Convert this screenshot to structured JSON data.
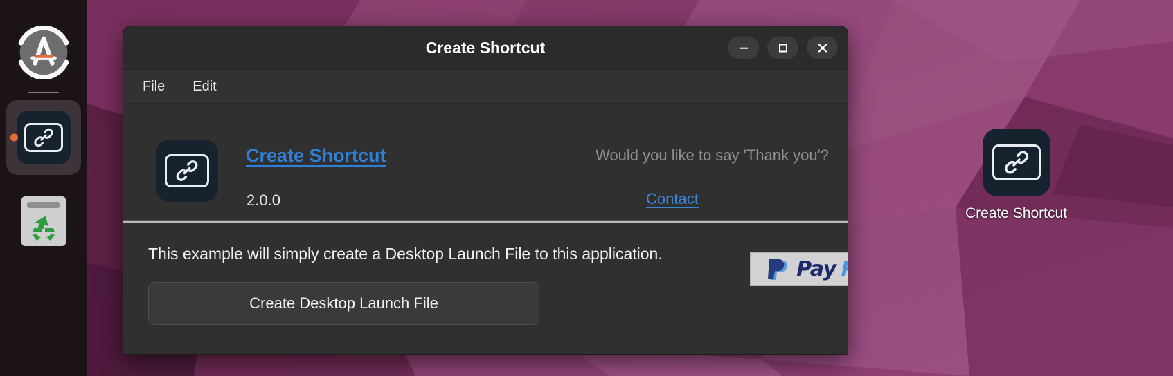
{
  "desktop": {
    "wallpaper_colors": {
      "base": "#6d2a52",
      "dark": "#4b1c3a",
      "mid": "#8a3a68",
      "light": "#a9588a",
      "lighter": "#bd76a0",
      "deep": "#3b1430"
    },
    "shortcut": {
      "label": "Create Shortcut",
      "icon": "link-chain-icon"
    }
  },
  "dock": {
    "items": [
      {
        "name": "ubuntu-software",
        "icon": "ubuntu-software-icon",
        "active": false
      },
      {
        "name": "create-shortcut",
        "icon": "link-chain-icon",
        "active": true
      },
      {
        "name": "trash",
        "icon": "trash-icon",
        "active": false
      }
    ],
    "accent_color": "#e8683a"
  },
  "window": {
    "title": "Create Shortcut",
    "controls": {
      "minimize": "minimize-icon",
      "maximize": "maximize-icon",
      "close": "close-icon"
    },
    "menubar": [
      {
        "label": "File"
      },
      {
        "label": "Edit"
      }
    ],
    "about": {
      "app_icon": "link-chain-icon",
      "app_name": "Create Shortcut",
      "app_name_color": "#2f80d8",
      "version": "2.0.0",
      "thanks_text": "Would you like to say 'Thank you'?",
      "contact_label": "Contact",
      "contact_color": "#3a86d9",
      "paypal": {
        "word_pay": "Pay",
        "word_pal": "Pal",
        "color_dark": "#1b2a6b",
        "color_light": "#3b9ae1",
        "background": "#d2d2d2"
      }
    },
    "body": {
      "description": "This example will simply create a Desktop Launch File to this application.",
      "action_button_label": "Create Desktop Launch File"
    }
  }
}
